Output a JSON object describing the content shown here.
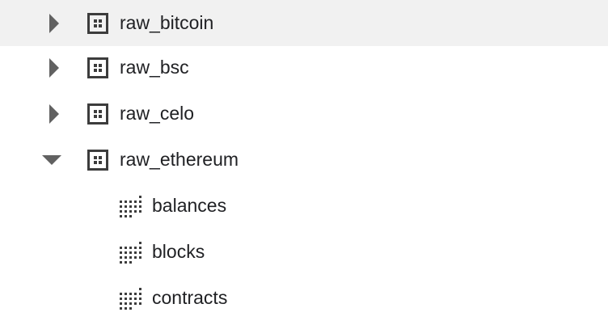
{
  "tree": {
    "items": [
      {
        "label": "raw_bitcoin",
        "type": "dataset",
        "state": "collapsed",
        "hovered": true,
        "icon": "dataset-icon"
      },
      {
        "label": "raw_bsc",
        "type": "dataset",
        "state": "collapsed",
        "icon": "dataset-icon"
      },
      {
        "label": "raw_celo",
        "type": "dataset",
        "state": "collapsed",
        "icon": "dataset-icon"
      },
      {
        "label": "raw_ethereum",
        "type": "dataset",
        "state": "expanded",
        "icon": "dataset-icon"
      },
      {
        "label": "balances",
        "type": "table",
        "icon": "table-icon"
      },
      {
        "label": "blocks",
        "type": "table",
        "icon": "table-icon"
      },
      {
        "label": "contracts",
        "type": "table",
        "icon": "table-icon"
      }
    ]
  },
  "colors": {
    "caret": "#616161",
    "icon": "#3c3c3c",
    "text": "#202124",
    "hover_bg": "#f1f1f1"
  }
}
